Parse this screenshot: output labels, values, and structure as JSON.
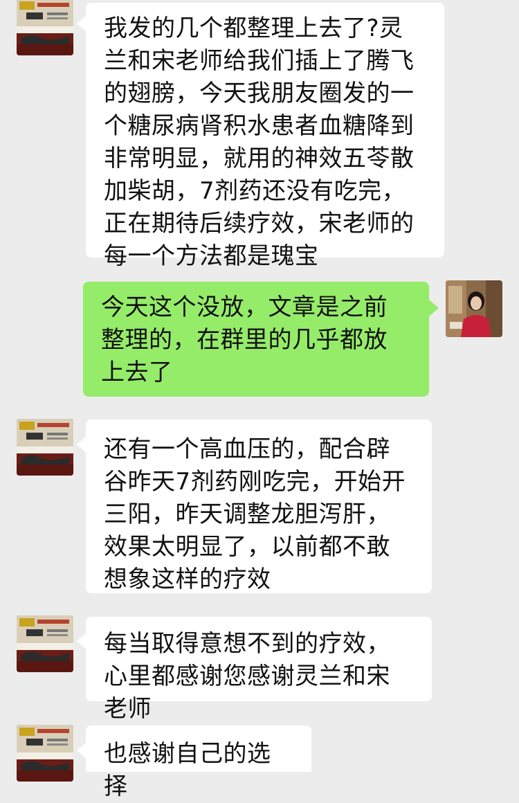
{
  "messages": [
    {
      "from": "contact",
      "text": "我发的几个都整理上去了?灵兰和宋老师给我们插上了腾飞的翅膀，今天我朋友圈发的一个糖尿病肾积水患者血糖降到非常明显，就用的神效五苓散加柴胡，7剂药还没有吃完，正在期待后续疗效，宋老师的每一个方法都是瑰宝"
    },
    {
      "from": "self",
      "text": "今天这个没放，文章是之前整理的，在群里的几乎都放上去了"
    },
    {
      "from": "contact",
      "text": "还有一个高血压的，配合辟谷昨天7剂药刚吃完，开始开三阳，昨天调整龙胆泻肝，效果太明显了，以前都不敢想象这样的疗效"
    },
    {
      "from": "contact",
      "text": "每当取得意想不到的疗效，心里都感谢您感谢灵兰和宋老师"
    },
    {
      "from": "contact",
      "text": "也感谢自己的选择"
    }
  ],
  "colors": {
    "background": "#ececec",
    "incoming_bubble": "#ffffff",
    "outgoing_bubble": "#95ec69"
  },
  "icons": {
    "contact_avatar": "contact-avatar-image",
    "self_avatar": "user-avatar-photo"
  }
}
